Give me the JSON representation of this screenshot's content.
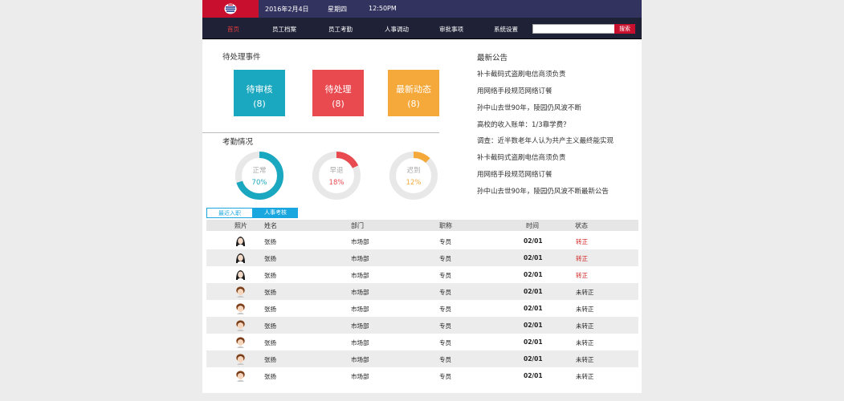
{
  "topbar": {
    "date": "2016年2月4日",
    "weekday": "星期四",
    "time": "12:50PM"
  },
  "nav": {
    "items": [
      {
        "label": "首页",
        "active": true
      },
      {
        "label": "员工档案",
        "active": false
      },
      {
        "label": "员工考勤",
        "active": false
      },
      {
        "label": "人事调动",
        "active": false
      },
      {
        "label": "审批事项",
        "active": false
      },
      {
        "label": "系统设置",
        "active": false
      }
    ],
    "search_value": "",
    "search_button": "搜索"
  },
  "pending": {
    "title": "待处理事件",
    "tiles": [
      {
        "label": "待审核",
        "count": "(8)",
        "color": "#1aa7c0"
      },
      {
        "label": "待处理",
        "count": "(8)",
        "color": "#e84a4f"
      },
      {
        "label": "最新动态",
        "count": "(8)",
        "color": "#f6a93b"
      }
    ]
  },
  "attendance": {
    "title": "考勤情况",
    "donuts": [
      {
        "label": "正常",
        "percent_text": "70%",
        "value": 0.7,
        "color": "#1aa7c0"
      },
      {
        "label": "早退",
        "percent_text": "18%",
        "value": 0.18,
        "color": "#e84a4f"
      },
      {
        "label": "迟到",
        "percent_text": "12%",
        "value": 0.12,
        "color": "#f6a93b"
      }
    ]
  },
  "notices": {
    "title": "最新公告",
    "items": [
      "补卡截码式盗刷电信商须负责",
      "用网络手段规范网络订餐",
      "孙中山去世90年，陵园仍风波不断",
      "高校的收入账单：1/3靠学费？",
      "调查：近半数老年人认为共产主义最终能实现",
      "补卡截码式盗刷电信商须负责",
      "用网络手段规范网络订餐",
      "孙中山去世90年，陵园仍风波不断最新公告"
    ]
  },
  "tabs": {
    "items": [
      "最近入职",
      "人事考核"
    ]
  },
  "table": {
    "headers": [
      "照片",
      "姓名",
      "部门",
      "职称",
      "时间",
      "状态"
    ],
    "rows": [
      {
        "avatar": "female",
        "name": "张扬",
        "dept": "市场部",
        "title": "专员",
        "time": "02/01",
        "status": "转正",
        "status_color": "#d21f1f"
      },
      {
        "avatar": "female",
        "name": "张扬",
        "dept": "市场部",
        "title": "专员",
        "time": "02/01",
        "status": "转正",
        "status_color": "#d21f1f"
      },
      {
        "avatar": "female",
        "name": "张扬",
        "dept": "市场部",
        "title": "专员",
        "time": "02/01",
        "status": "转正",
        "status_color": "#d21f1f"
      },
      {
        "avatar": "male",
        "name": "张扬",
        "dept": "市场部",
        "title": "专员",
        "time": "02/01",
        "status": "未转正",
        "status_color": "#222222"
      },
      {
        "avatar": "male",
        "name": "张扬",
        "dept": "市场部",
        "title": "专员",
        "time": "02/01",
        "status": "未转正",
        "status_color": "#222222"
      },
      {
        "avatar": "male",
        "name": "张扬",
        "dept": "市场部",
        "title": "专员",
        "time": "02/01",
        "status": "未转正",
        "status_color": "#222222"
      },
      {
        "avatar": "male",
        "name": "张扬",
        "dept": "市场部",
        "title": "专员",
        "time": "02/01",
        "status": "未转正",
        "status_color": "#222222"
      },
      {
        "avatar": "male",
        "name": "张扬",
        "dept": "市场部",
        "title": "专员",
        "time": "02/01",
        "status": "未转正",
        "status_color": "#222222"
      },
      {
        "avatar": "male",
        "name": "张扬",
        "dept": "市场部",
        "title": "专员",
        "time": "02/01",
        "status": "未转正",
        "status_color": "#222222"
      }
    ]
  }
}
